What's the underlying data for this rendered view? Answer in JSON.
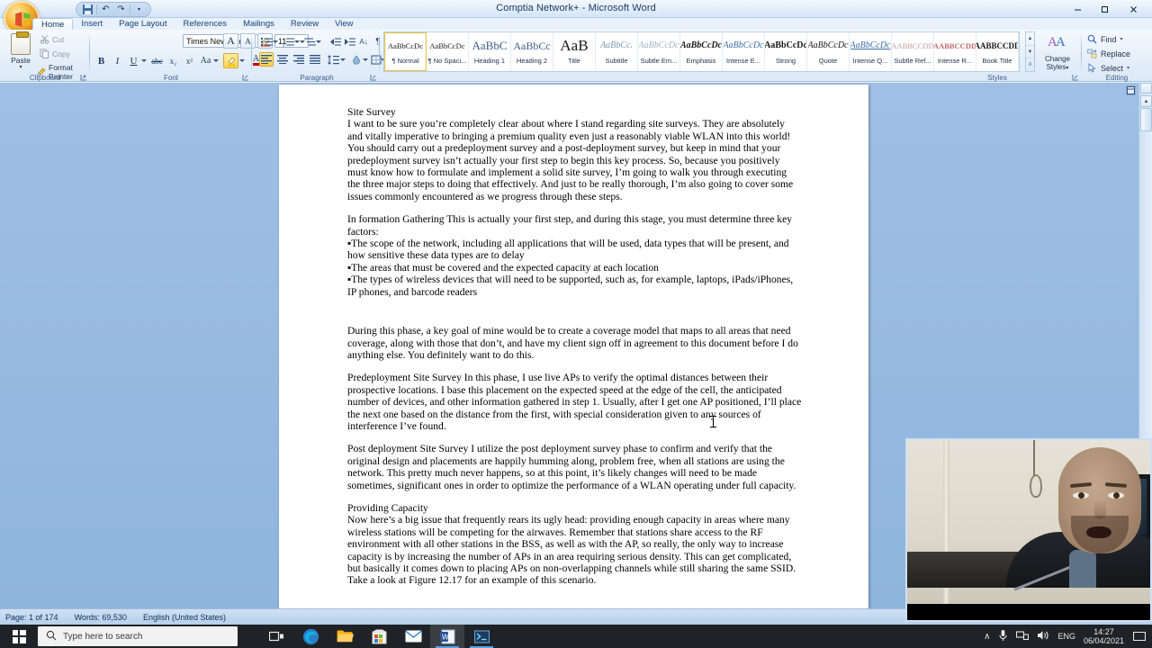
{
  "window": {
    "title": "Comptia Network+ - Microsoft Word",
    "minimize": "–",
    "maximize": "❐",
    "close": "✕"
  },
  "quick_access": {
    "save": "save-icon",
    "undo": "↶",
    "redo": "↷",
    "customize": "▾"
  },
  "tabs": [
    {
      "label": "Home",
      "active": true
    },
    {
      "label": "Insert",
      "active": false
    },
    {
      "label": "Page Layout",
      "active": false
    },
    {
      "label": "References",
      "active": false
    },
    {
      "label": "Mailings",
      "active": false
    },
    {
      "label": "Review",
      "active": false
    },
    {
      "label": "View",
      "active": false
    }
  ],
  "ribbon": {
    "clipboard": {
      "group_label": "Clipboard",
      "paste_label": "Paste",
      "paste_arrow": "▾",
      "cut": "Cut",
      "copy": "Copy",
      "format_painter": "Format Painter"
    },
    "font": {
      "group_label": "Font",
      "font_name": "Times New Roman",
      "font_size": "11",
      "grow_font": "A",
      "shrink_font": "A",
      "clear_formatting": "⌫",
      "bold": "B",
      "italic": "I",
      "underline": "U",
      "strikethrough": "abc",
      "subscript": "x₂",
      "superscript": "x²",
      "change_case": "Aa",
      "text_highlight": "ab",
      "font_color": "A"
    },
    "paragraph": {
      "group_label": "Paragraph",
      "bullets": "≡",
      "numbering": "≡",
      "multilevel": "≡",
      "decrease_indent": "⇤",
      "increase_indent": "⇥",
      "sort": "A↓",
      "show_marks": "¶",
      "align_left": "≡",
      "align_center": "≡",
      "align_right": "≡",
      "justify": "≡",
      "line_spacing": "↕",
      "shading": "▤",
      "borders": "⊞"
    },
    "styles": {
      "group_label": "Styles",
      "items": [
        {
          "preview": "AaBbCcDc",
          "name": "¶ Normal",
          "selected": true
        },
        {
          "preview": "AaBbCcDc",
          "name": "¶ No Spaci...",
          "selected": false
        },
        {
          "preview": "AaBbC",
          "name": "Heading 1",
          "selected": false
        },
        {
          "preview": "AaBbCc",
          "name": "Heading 2",
          "selected": false
        },
        {
          "preview": "AaB",
          "name": "Title",
          "selected": false
        },
        {
          "preview": "AaBbCc.",
          "name": "Subtitle",
          "selected": false
        },
        {
          "preview": "AaBbCcDc",
          "name": "Subtle Em...",
          "selected": false
        },
        {
          "preview": "AaBbCcDc",
          "name": "Emphasis",
          "selected": false
        },
        {
          "preview": "AaBbCcDc",
          "name": "Intense E...",
          "selected": false
        },
        {
          "preview": "AaBbCcDc",
          "name": "Strong",
          "selected": false
        },
        {
          "preview": "AaBbCcDc",
          "name": "Quote",
          "selected": false
        },
        {
          "preview": "AaBbCcDc",
          "name": "Intense Q...",
          "selected": false
        },
        {
          "preview": "AABBCCDD",
          "name": "Subtle Ref...",
          "selected": false
        },
        {
          "preview": "AABBCCDD",
          "name": "Intense R...",
          "selected": false
        },
        {
          "preview": "AABBCCDD",
          "name": "Book Title",
          "selected": false
        }
      ],
      "scroll_up": "▲",
      "scroll_down": "▼",
      "scroll_more": "≡"
    },
    "change_styles": {
      "label_line1": "Change",
      "label_line2": "Styles",
      "arrow": "▾"
    },
    "editing": {
      "group_label": "Editing",
      "find": "Find",
      "replace": "Replace",
      "select": "Select",
      "find_arrow": "▾",
      "select_arrow": "▾"
    }
  },
  "document": {
    "paragraphs": [
      {
        "text": "Site Survey",
        "style": "tight"
      },
      {
        "text": "I want to be sure you’re completely clear about where I stand regarding site surveys. They are absolutely and vitally imperative to bringing a premium quality even just a reasonably viable WLAN into this world! You should carry out a predeployment survey and a post-deployment survey, but keep in mind that your predeployment survey isn’t actually your first step to begin this key process. So, because you positively must know how to formulate and implement a solid site survey, I’m going to walk you through executing the three major steps to doing that effectively. And just to be really thorough, I’m also going to cover some issues commonly encountered as we progress through these steps.",
        "style": ""
      },
      {
        "text": "In formation Gathering This is actually your first step, and during this stage, you must determine three key factors:",
        "style": "tight"
      },
      {
        "text": "▪The scope of the network, including all applications that will be used, data types that will be present, and how sensitive these data types are to delay",
        "style": "tight"
      },
      {
        "text": "▪The areas that must be covered and the expected capacity at each location",
        "style": "tight"
      },
      {
        "text": "▪The types of wireless devices that will need to be supported, such as, for example, laptops, iPads/iPhones, IP phones, and barcode readers",
        "style": "gap-lg"
      },
      {
        "text": "During this phase, a key goal of mine would be to create a coverage model that maps to all areas that need coverage, along with those that don’t, and have my client sign off in agreement to this document before I do anything else. You definitely want to do this.",
        "style": ""
      },
      {
        "text": "Predeployment Site Survey In this phase, I use live APs to verify the optimal distances between their prospective locations. I base this placement on the expected speed at the edge of the cell, the anticipated number of devices, and other information gathered in step 1. Usually, after I get one AP positioned, I’ll place the next one based on the distance from the first, with special consideration given to any sources of interference I’ve found.",
        "style": ""
      },
      {
        "text": "Post deployment Site Survey I utilize the post deployment survey phase to confirm and verify that the original design and placements are happily humming along, problem free, when all stations are using the network. This pretty much never happens, so at this point, it’s likely changes will need to be made sometimes, significant ones in order to optimize the performance of a WLAN operating under full capacity.",
        "style": ""
      },
      {
        "text": "Providing Capacity",
        "style": "tight"
      },
      {
        "text": "Now here’s a big issue that frequently rears its ugly head: providing enough capacity in areas where many wireless stations will be competing for the airwaves. Remember that stations share access to the RF environment with all other stations in the BSS, as well as with the AP, so really, the only way to increase capacity is by increasing the number of APs in an area requiring serious density. This can get complicated, but basically it comes down to placing APs on non-overlapping channels while still sharing the same SSID. Take a look at Figure 12.17 for an example of this scenario.",
        "style": ""
      }
    ]
  },
  "status_bar": {
    "page": "Page: 1 of 174",
    "words": "Words: 69,530",
    "language": "English (United States)"
  },
  "taskbar": {
    "search_placeholder": "Type here to search",
    "icons": [
      {
        "name": "task-view-icon"
      },
      {
        "name": "edge-icon"
      },
      {
        "name": "file-explorer-icon"
      },
      {
        "name": "microsoft-store-icon"
      },
      {
        "name": "mail-icon"
      },
      {
        "name": "word-icon"
      },
      {
        "name": "terminal-icon"
      }
    ],
    "tray": {
      "show_hidden": "∧",
      "language": "ENG",
      "time": "14:27",
      "date": "06/04/2021"
    }
  },
  "scrollbar": {
    "up_arrow": "▲",
    "down_arrow": "▼"
  },
  "colors": {
    "ribbon_bg": "#e7f0fa",
    "accent": "#3b6ea5",
    "doc_bg": "#95b9e0",
    "taskbar": "#1f2227",
    "highlight": "#ffd24a"
  }
}
